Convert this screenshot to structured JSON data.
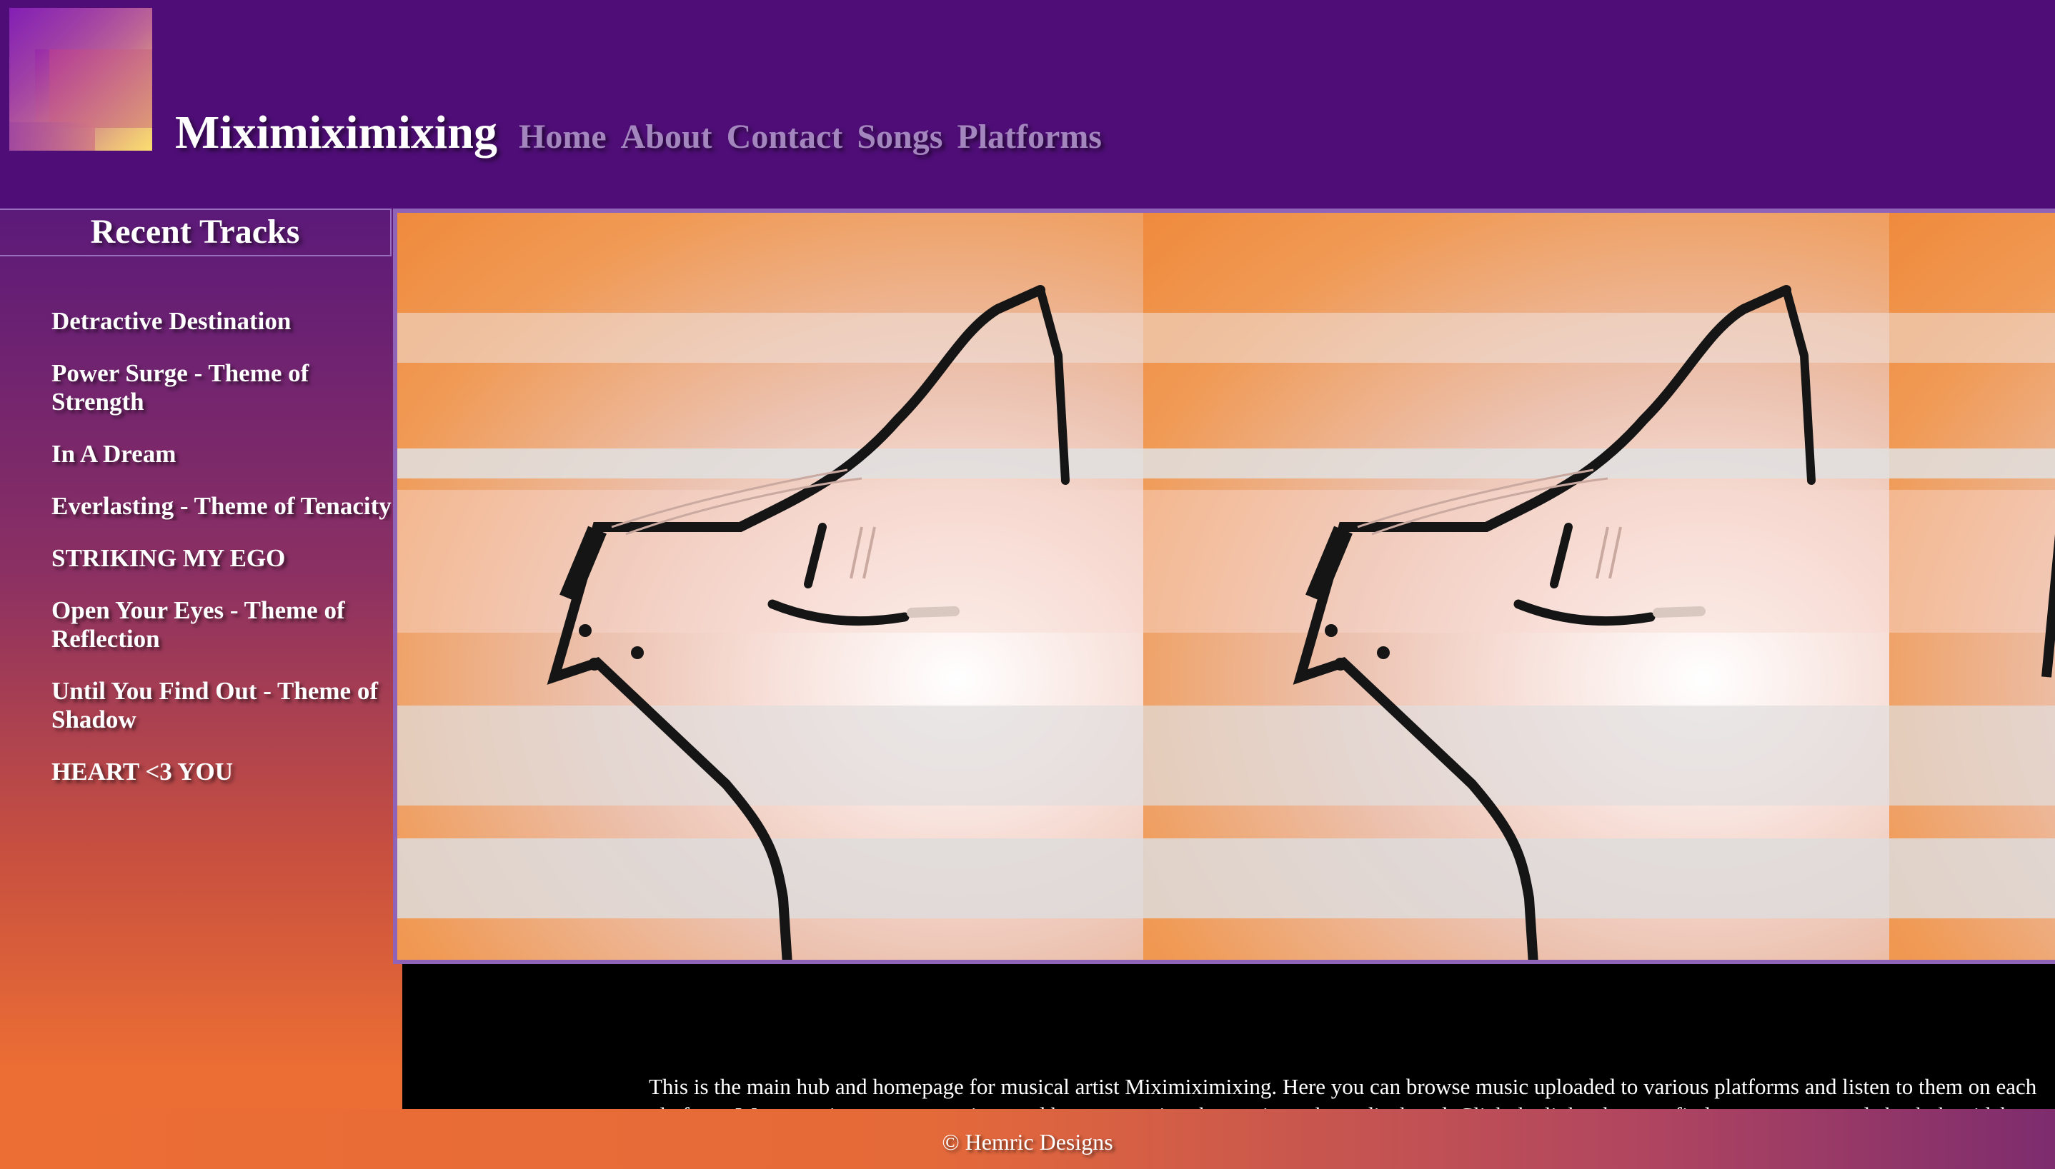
{
  "header": {
    "logo_icon": "site-logo",
    "title": "Miximiximixing",
    "nav": [
      {
        "label": "Home"
      },
      {
        "label": "About"
      },
      {
        "label": "Contact"
      },
      {
        "label": "Songs"
      },
      {
        "label": "Platforms"
      }
    ]
  },
  "sidebar": {
    "heading": "Recent Tracks",
    "tracks": [
      {
        "label": "Detractive Destination"
      },
      {
        "label": "Power Surge - Theme of Strength"
      },
      {
        "label": "In A Dream"
      },
      {
        "label": "Everlasting - Theme of Tenacity"
      },
      {
        "label": "STRIKING MY EGO"
      },
      {
        "label": "Open Your Eyes - Theme of Reflection"
      },
      {
        "label": "Until You Find Out - Theme of Shadow"
      },
      {
        "label": "HEART <3 YOU"
      }
    ]
  },
  "main": {
    "banner_image": "guitar-illustration",
    "intro": "This is the main hub and homepage for musical artist Miximiximixing. Here you can browse music uploaded to various platforms and listen to them on each platform. We appreciate any suggestions and hope you enjoy the music we have displayed. Click the links above to find more content and check the sidebar for the most recent tracks."
  },
  "footer": {
    "text": "© Hemric Designs"
  },
  "colors": {
    "header_bg": "#4f0e77",
    "nav_link": "#a486be",
    "banner_border": "#8f63b8",
    "footer_orange": "#ec6e34"
  }
}
